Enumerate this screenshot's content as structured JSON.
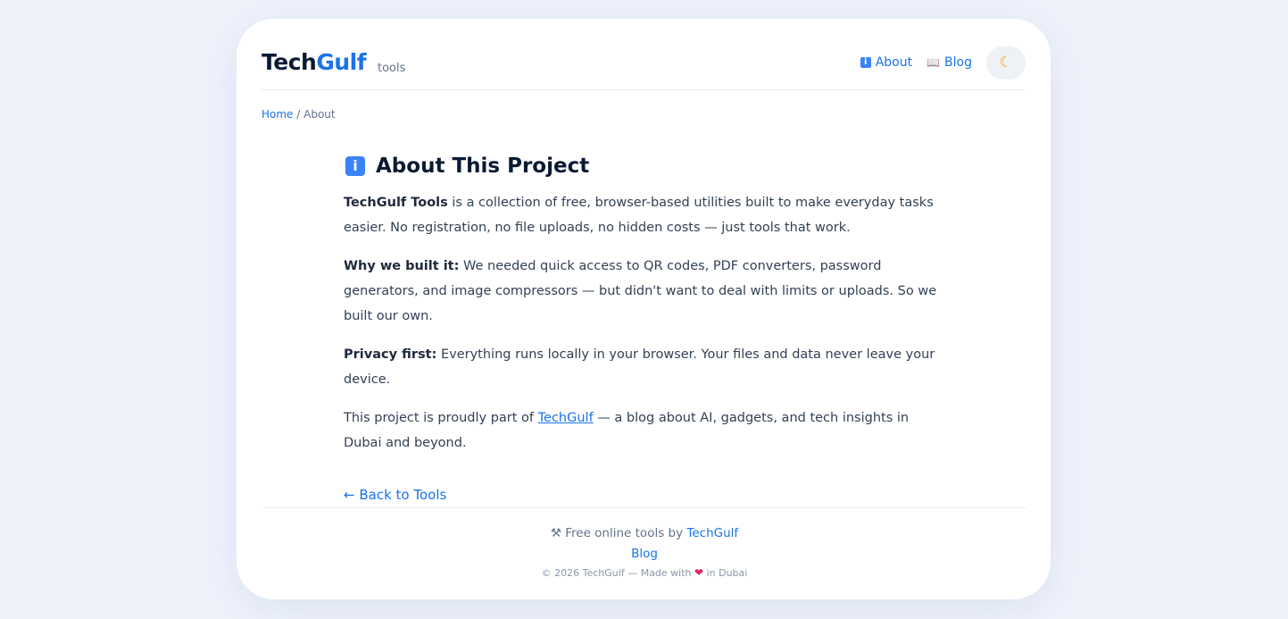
{
  "header": {
    "logo_tech": "Tech",
    "logo_gulf": "Gulf",
    "logo_sub": "tools",
    "nav": {
      "about_label": "About",
      "blog_label": "Blog"
    },
    "theme_icon": "moon-icon"
  },
  "breadcrumb": {
    "home": "Home",
    "separator": "/",
    "current": "About"
  },
  "main": {
    "title": "About This Project",
    "p1_bold": "TechGulf Tools",
    "p1_text": " is a collection of free, browser-based utilities built to make everyday tasks easier. No registration, no file uploads, no hidden costs — just tools that work.",
    "p2_bold": "Why we built it:",
    "p2_text": " We needed quick access to QR codes, PDF converters, password generators, and image compressors — but didn't want to deal with limits or uploads. So we built our own.",
    "p3_bold": "Privacy first:",
    "p3_text": " Everything runs locally in your browser. Your files and data never leave your device.",
    "p4_pre": "This project is proudly part of ",
    "p4_link": "TechGulf",
    "p4_post": " — a blog about AI, gadgets, and tech insights in Dubai and beyond.",
    "back_label": "← Back to Tools"
  },
  "footer": {
    "line1_pre": "Free online tools by ",
    "line1_link": "TechGulf",
    "blog_link": "Blog",
    "copyright_pre": "© 2026 TechGulf — Made with ",
    "copyright_post": " in Dubai"
  },
  "colors": {
    "accent": "#1a73e8",
    "background": "#eef2fb",
    "heart": "#e0245e"
  }
}
